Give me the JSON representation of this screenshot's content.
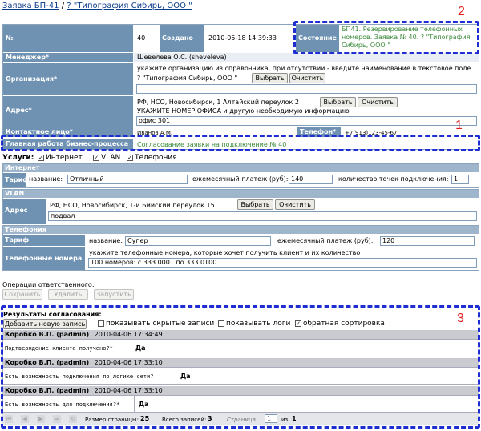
{
  "title": {
    "text": "Заявка БП-41",
    "sep": "/",
    "link": "? \"Типография Сибирь, ООО \""
  },
  "head": {
    "num_label": "№",
    "num_value": "40",
    "created_label": "Создано",
    "created_value": "2010-05-18 14:39:33",
    "state_label": "Состояние",
    "state_value": "БП41. Резервирование телефонных номеров. Заявка № 40. ? \"Типография Сибирь, ООО \""
  },
  "manager": {
    "label": "Менеджер*",
    "value": "Шевелева О.С. (sheveleva)"
  },
  "org": {
    "label": "Организация*",
    "hint": "укажите организацию из справочника, при отсутствии - введите наименование в текстовое поле",
    "value": "? \"Типография Сибирь, ООО \"",
    "btn_select": "Выбрать",
    "btn_clear": "Очистить"
  },
  "address": {
    "label": "Адрес*",
    "value": "РФ, НСО, Новосибирск, 1 Алтайский переулок 2",
    "btn_select": "Выбрать",
    "btn_clear": "Очистить",
    "hint": "УКАЖИТЕ НОМЕР ОФИСА и другую необходимую информацию",
    "extra": "офис 301"
  },
  "contact": {
    "label": "Контактное лицо*",
    "value": "Иванов А.М.",
    "phone_label": "Телефон*",
    "phone_value": "+7(913)123-45-67"
  },
  "mainwork": {
    "label": "Главная работа бизнес-процесса",
    "value": "Согласование заявки на подключение № 40"
  },
  "services": {
    "label": "Услуги:",
    "items": [
      {
        "label": "Интернет",
        "checked": "✓"
      },
      {
        "label": "VLAN",
        "checked": "✓"
      },
      {
        "label": "Телефония",
        "checked": "✓"
      }
    ]
  },
  "internet": {
    "section": "Интернет",
    "tariff_label": "Тариф",
    "name_label": "название:",
    "name_value": "Отличный",
    "fee_label": "ежемесячный платеж (руб):",
    "fee_value": "140",
    "points_label": "количество точек подключения:",
    "points_value": "1"
  },
  "vlan": {
    "section": "VLAN",
    "address_label": "Адрес",
    "address_value": "РФ, НСО, Новосибирск, 1-й Бийский переулок 15",
    "btn_select": "Выбрать",
    "btn_clear": "Очистить",
    "extra": "подвал"
  },
  "telephony": {
    "section": "Телефония",
    "tariff_label": "Тариф",
    "name_label": "название:",
    "name_value": "Супер",
    "fee_label": "ежемесячный платеж (руб):",
    "fee_value": "120",
    "phones_label": "Телефонные номера",
    "phones_hint": "укажите телефонные номера, которые хочет получить клиент и их количество",
    "phones_value": "100 номеров: с 333 0001 по 333 0100"
  },
  "ops": {
    "label": "Операции ответственного:",
    "save": "Сохранить",
    "delete": "Удалить",
    "run": "Запустить"
  },
  "results": {
    "label": "Результаты согласования:",
    "add_btn": "Добавить новую запись",
    "opt_hidden": "показывать скрытые записи",
    "opt_logs": "показывать логи",
    "opt_reverse": "обратная сортировка",
    "opt_reverse_checked": "✓",
    "records": [
      {
        "author": "Коробко В.П. (padmin)",
        "time": "2010-04-06 17:34:49",
        "question": "Подтверждение клиента получено?*",
        "answer": "Да"
      },
      {
        "author": "Коробко В.П. (padmin)",
        "time": "2010-04-06 17:33:10",
        "question": "Есть возможность подключения по логике сети?",
        "answer": "Да"
      },
      {
        "author": "Коробко В.П. (padmin)",
        "time": "2010-04-06 17:33:10",
        "question": "Есть возможность для подключения?*",
        "answer": "Да"
      }
    ],
    "pager": {
      "page_size_label": "Размер страницы:",
      "page_size": "25",
      "total_label": "Всего записей:",
      "total": "3",
      "page_label": "Страница:",
      "page": "1",
      "of_label": "из",
      "of": "1"
    }
  },
  "annotations": {
    "n1": "1",
    "n2": "2",
    "n3": "3"
  },
  "colors": {
    "header": "#6f92b3",
    "annotation": "#1f2ed2",
    "marker": "#e02020"
  }
}
